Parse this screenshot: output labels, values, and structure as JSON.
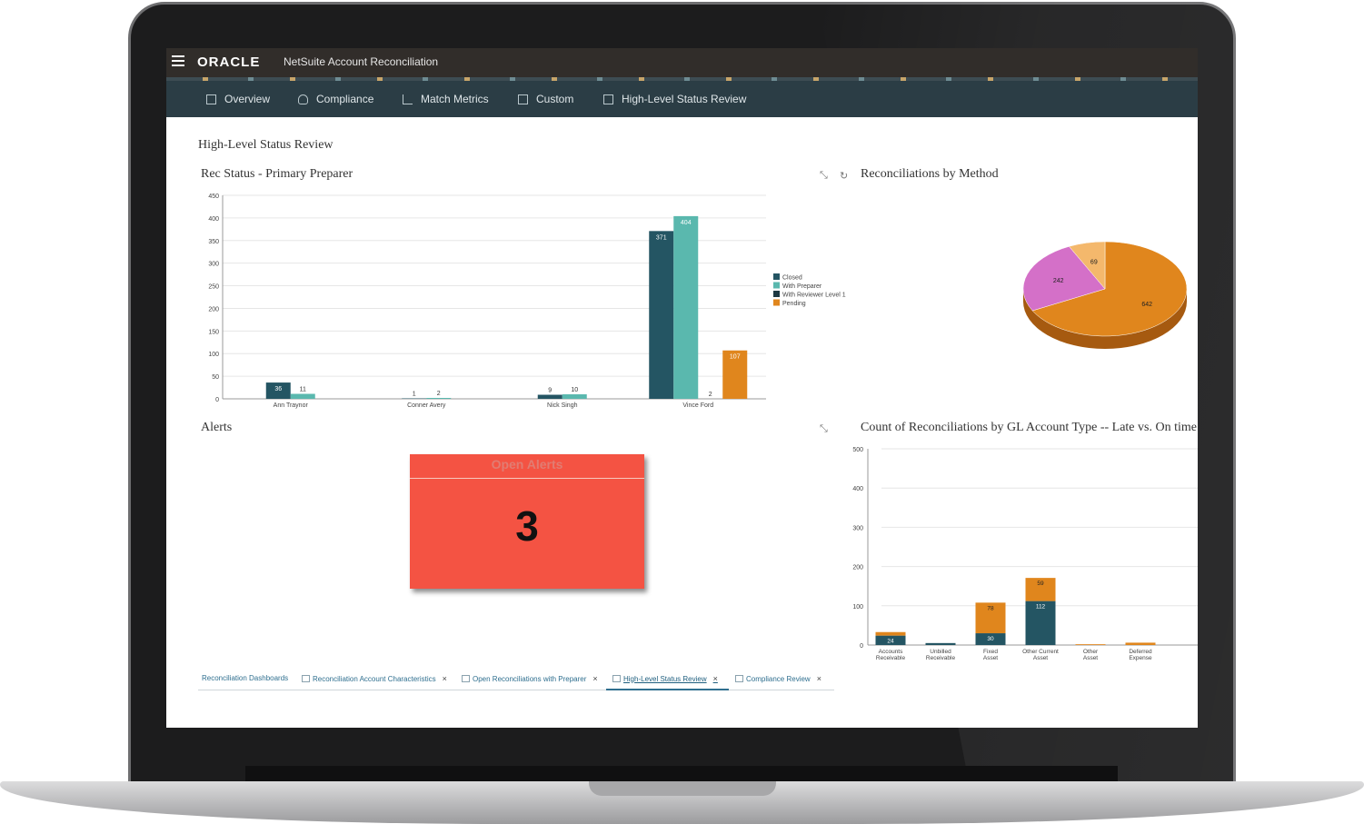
{
  "app": {
    "brand": "ORACLE",
    "title": "NetSuite Account Reconciliation"
  },
  "nav": [
    {
      "label": "Overview",
      "icon": "panel-icon"
    },
    {
      "label": "Compliance",
      "icon": "users-icon"
    },
    {
      "label": "Match Metrics",
      "icon": "chart-icon"
    },
    {
      "label": "Custom",
      "icon": "grid-icon"
    },
    {
      "label": "High-Level Status Review",
      "icon": "grid-icon"
    }
  ],
  "page_title": "High-Level Status Review",
  "panels": {
    "rec_status": "Rec Status - Primary Preparer",
    "by_method": "Reconciliations by Method",
    "alerts": "Alerts",
    "gl_type": "Count of Reconciliations by GL Account Type -- Late vs. On time"
  },
  "alerts": {
    "label": "Open Alerts",
    "count": "3"
  },
  "tabs": [
    {
      "label": "Reconciliation Dashboards",
      "closable": false
    },
    {
      "label": "Reconciliation Account Characteristics",
      "closable": true
    },
    {
      "label": "Open Reconciliations with Preparer",
      "closable": true
    },
    {
      "label": "High-Level Status Review",
      "closable": true,
      "active": true
    },
    {
      "label": "Compliance Review",
      "closable": true
    }
  ],
  "colors": {
    "closed": "#245563",
    "with_preparer": "#5ab8ae",
    "with_reviewer": "#1d3942",
    "pending": "#e0861d",
    "pie_magenta": "#d470c8",
    "pie_light": "#f4b86c",
    "alert_red": "#f45343"
  },
  "chart_data": [
    {
      "type": "bar",
      "title": "Rec Status - Primary Preparer",
      "categories": [
        "Ann Traynor",
        "Conner Avery",
        "Nick Singh",
        "Vince Ford"
      ],
      "series": [
        {
          "name": "Closed",
          "values": [
            36,
            1,
            9,
            371
          ]
        },
        {
          "name": "With Preparer",
          "values": [
            11,
            2,
            10,
            404
          ]
        },
        {
          "name": "With Reviewer Level 1",
          "values": [
            0,
            0,
            0,
            0
          ]
        },
        {
          "name": "Pending",
          "values": [
            0,
            0,
            0,
            107
          ]
        }
      ],
      "data_labels": [
        [
          "36",
          "11",
          "",
          ""
        ],
        [
          "1",
          "2",
          "",
          ""
        ],
        [
          "9",
          "10",
          "",
          ""
        ],
        [
          "371",
          "404",
          "2",
          "107"
        ]
      ],
      "ylim": [
        0,
        450
      ],
      "yticks": [
        0,
        50,
        100,
        150,
        200,
        250,
        300,
        350,
        400,
        450
      ],
      "legend": "right",
      "grid": true
    },
    {
      "type": "pie",
      "title": "Reconciliations by Method",
      "values": [
        642,
        242,
        69
      ],
      "value_labels": [
        "642",
        "242",
        "69"
      ]
    },
    {
      "type": "bar",
      "stacked": true,
      "title": "Count of Reconciliations by GL Account Type -- Late vs. On time",
      "categories": [
        "Accounts Receivable",
        "Unbilled Receivable",
        "Fixed Asset",
        "Other Current Asset",
        "Other Asset",
        "Deferred Expense"
      ],
      "series": [
        {
          "values": [
            24,
            5,
            30,
            112,
            0,
            0
          ]
        },
        {
          "values": [
            9,
            0,
            78,
            59,
            2,
            6
          ]
        }
      ],
      "data_labels": [
        [
          "24",
          "",
          "30",
          "112",
          "",
          ""
        ],
        [
          "",
          "",
          "78",
          "59",
          "",
          ""
        ]
      ],
      "ylim": [
        0,
        500
      ],
      "yticks": [
        0,
        100,
        200,
        300,
        400,
        500
      ],
      "grid": true
    }
  ]
}
